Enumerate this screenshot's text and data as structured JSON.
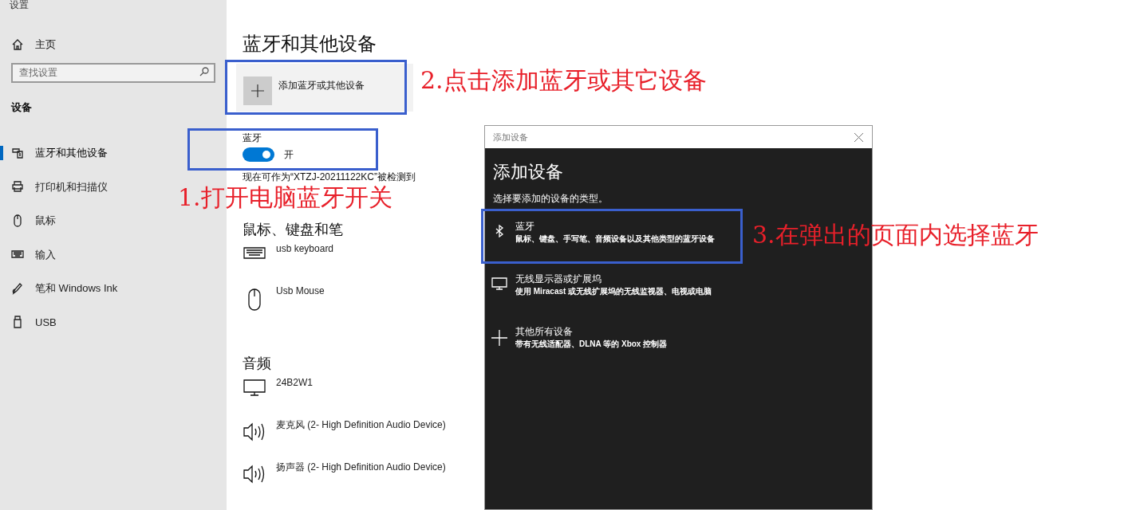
{
  "window": {
    "title": "设置"
  },
  "sidebar": {
    "home": "主页",
    "search": {
      "placeholder": "查找设置"
    },
    "section": "设备",
    "items": [
      {
        "label": "蓝牙和其他设备",
        "kind": "bluetooth",
        "selected": true
      },
      {
        "label": "打印机和扫描仪",
        "kind": "printer",
        "selected": false
      },
      {
        "label": "鼠标",
        "kind": "mouse",
        "selected": false
      },
      {
        "label": "输入",
        "kind": "keyboard",
        "selected": false
      },
      {
        "label": "笔和 Windows Ink",
        "kind": "pen",
        "selected": false
      },
      {
        "label": "USB",
        "kind": "usb",
        "selected": false
      }
    ]
  },
  "main": {
    "title": "蓝牙和其他设备",
    "add_button": "添加蓝牙或其他设备",
    "bluetooth": {
      "label": "蓝牙",
      "on": true,
      "state": "开"
    },
    "discoverable": "现在可作为“XTZJ-20211122KC”被检测到",
    "sections": [
      {
        "title": "鼠标、键盘和笔",
        "devices": [
          {
            "name": "usb keyboard",
            "kind": "keyboard"
          },
          {
            "name": "Usb Mouse",
            "kind": "mouse"
          }
        ]
      },
      {
        "title": "音频",
        "devices": [
          {
            "name": "24B2W1",
            "kind": "monitor"
          },
          {
            "name": "麦克风 (2- High Definition Audio Device)",
            "kind": "speaker"
          },
          {
            "name": "扬声器 (2- High Definition Audio Device)",
            "kind": "speaker"
          }
        ]
      }
    ]
  },
  "dialog": {
    "title": "添加设备",
    "heading": "添加设备",
    "subtitle": "选择要添加的设备的类型。",
    "options": [
      {
        "title": "蓝牙",
        "description": "鼠标、键盘、手写笔、音频设备以及其他类型的蓝牙设备",
        "kind": "bluetooth"
      },
      {
        "title": "无线显示器或扩展坞",
        "description": "使用 Miracast 或无线扩展坞的无线监视器、电视或电脑",
        "kind": "monitor"
      },
      {
        "title": "其他所有设备",
        "description": "带有无线适配器、DLNA 等的 Xbox 控制器",
        "kind": "plus"
      }
    ]
  },
  "annotations": [
    "2.点击添加蓝牙或其它设备",
    "1.打开电脑蓝牙开关",
    "3.在弹出的页面内选择蓝牙"
  ]
}
